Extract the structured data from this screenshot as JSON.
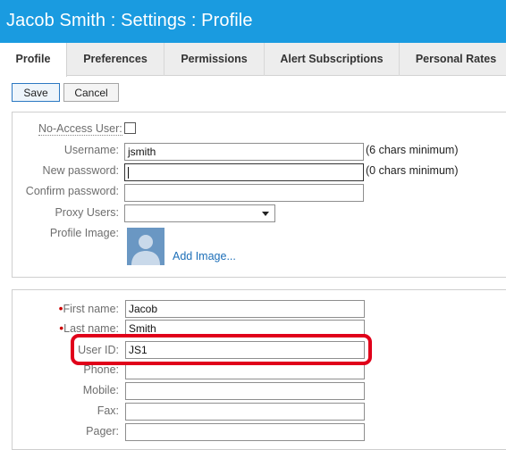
{
  "window": {
    "title": "Jacob Smith : Settings : Profile"
  },
  "tabs": [
    {
      "label": "Profile",
      "active": true
    },
    {
      "label": "Preferences",
      "active": false
    },
    {
      "label": "Permissions",
      "active": false
    },
    {
      "label": "Alert Subscriptions",
      "active": false
    },
    {
      "label": "Personal Rates",
      "active": false
    }
  ],
  "toolbar": {
    "save_label": "Save",
    "cancel_label": "Cancel"
  },
  "account": {
    "no_access_label": "No-Access User:",
    "no_access_checked": false,
    "username_label": "Username:",
    "username_value": "jsmith",
    "username_hint": "(6 chars minimum)",
    "new_password_label": "New password:",
    "new_password_value": "",
    "new_password_hint": "(0 chars minimum)",
    "confirm_password_label": "Confirm password:",
    "confirm_password_value": "",
    "proxy_users_label": "Proxy Users:",
    "proxy_users_value": "",
    "profile_image_label": "Profile Image:",
    "add_image_label": "Add Image..."
  },
  "contact": {
    "first_name_label": "First name:",
    "first_name_value": "Jacob",
    "last_name_label": "Last name:",
    "last_name_value": "Smith",
    "user_id_label": "User ID:",
    "user_id_value": "JS1",
    "phone_label": "Phone:",
    "phone_value": "",
    "mobile_label": "Mobile:",
    "mobile_value": "",
    "fax_label": "Fax:",
    "fax_value": "",
    "pager_label": "Pager:",
    "pager_value": ""
  },
  "colors": {
    "title_bar": "#1a9be0",
    "required_marker": "#cc0000",
    "highlight_box": "#e0001a",
    "link": "#1d6fb8"
  },
  "icons": {
    "profile_image": "user-silhouette-icon",
    "proxy_dropdown": "chevron-down-icon"
  }
}
